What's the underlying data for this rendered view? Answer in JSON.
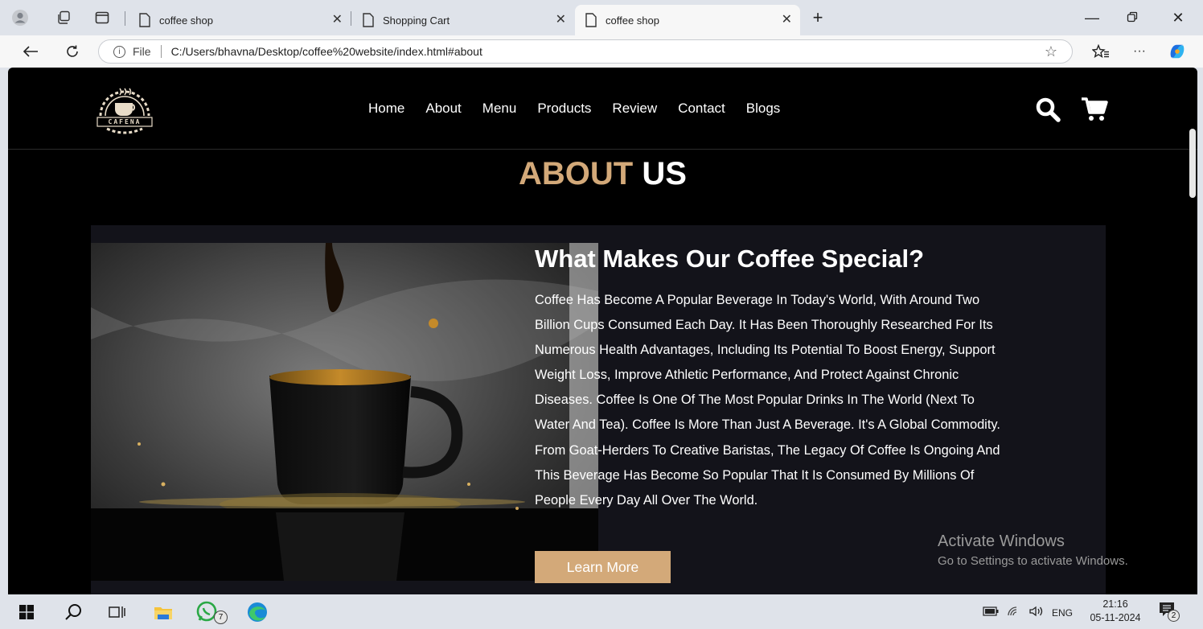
{
  "browser": {
    "tabs": [
      {
        "title": "coffee shop",
        "active": false
      },
      {
        "title": "Shopping Cart",
        "active": false
      },
      {
        "title": "coffee shop",
        "active": true
      }
    ],
    "new_tab_label": "+",
    "address": {
      "scheme_label": "File",
      "url": "C:/Users/bhavna/Desktop/coffee%20website/index.html#about"
    },
    "more_label": "···"
  },
  "site": {
    "logo_text": "CAFENA",
    "nav": [
      "Home",
      "About",
      "Menu",
      "Products",
      "Review",
      "Contact",
      "Blogs"
    ],
    "about": {
      "heading_accent": "ABOUT",
      "heading_rest": "US",
      "title": "What Makes Our Coffee Special?",
      "body": "Coffee Has Become A Popular Beverage In Today's World, With Around Two Billion Cups Consumed Each Day. It Has Been Thoroughly Researched For Its Numerous Health Advantages, Including Its Potential To Boost Energy, Support Weight Loss, Improve Athletic Performance, And Protect Against Chronic Diseases. Coffee Is One Of The Most Popular Drinks In The World (Next To Water And Tea). Coffee Is More Than Just A Beverage. It's A Global Commodity. From Goat-Herders To Creative Baristas, The Legacy Of Coffee Is Ongoing And This Beverage Has Become So Popular That It Is Consumed By Millions Of People Every Day All Over The World.",
      "button": "Learn More"
    },
    "colors": {
      "accent": "#d3a979",
      "background": "#000000",
      "panel": "#13131a"
    }
  },
  "watermark": {
    "line1": "Activate Windows",
    "line2": "Go to Settings to activate Windows."
  },
  "taskbar": {
    "whatsapp_badge": "7",
    "language": "ENG",
    "time": "21:16",
    "date": "05-11-2024",
    "notification_count": "2"
  }
}
